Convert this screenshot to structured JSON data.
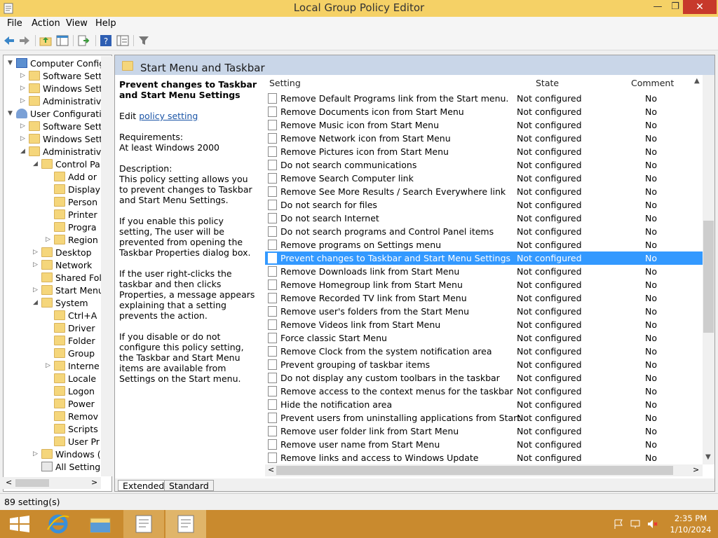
{
  "window": {
    "title": "Local Group Policy Editor"
  },
  "menu": [
    "File",
    "Action",
    "View",
    "Help"
  ],
  "tree": [
    {
      "label": "Computer Config",
      "level": 0,
      "exp": "▼",
      "icon": "computer-icon"
    },
    {
      "label": "Software Setti",
      "level": 1,
      "exp": "▷",
      "icon": "folder-icon"
    },
    {
      "label": "Windows Sett",
      "level": 1,
      "exp": "▷",
      "icon": "folder-icon"
    },
    {
      "label": "Administrative",
      "level": 1,
      "exp": "▷",
      "icon": "folder-icon"
    },
    {
      "label": "User Configuratio",
      "level": 0,
      "exp": "▼",
      "icon": "user-icon"
    },
    {
      "label": "Software Setti",
      "level": 1,
      "exp": "▷",
      "icon": "folder-icon"
    },
    {
      "label": "Windows Setti",
      "level": 1,
      "exp": "▷",
      "icon": "folder-icon"
    },
    {
      "label": "Administrative",
      "level": 1,
      "exp": "◢",
      "icon": "folder-icon"
    },
    {
      "label": "Control Pa",
      "level": 2,
      "exp": "◢",
      "icon": "folder-icon"
    },
    {
      "label": "Add or",
      "level": 3,
      "exp": "",
      "icon": "folder-icon"
    },
    {
      "label": "Display",
      "level": 3,
      "exp": "",
      "icon": "folder-icon"
    },
    {
      "label": "Person",
      "level": 3,
      "exp": "",
      "icon": "folder-icon"
    },
    {
      "label": "Printer",
      "level": 3,
      "exp": "",
      "icon": "folder-icon"
    },
    {
      "label": "Progra",
      "level": 3,
      "exp": "",
      "icon": "folder-icon"
    },
    {
      "label": "Region",
      "level": 3,
      "exp": "▷",
      "icon": "folder-icon"
    },
    {
      "label": "Desktop",
      "level": 2,
      "exp": "▷",
      "icon": "folder-icon"
    },
    {
      "label": "Network",
      "level": 2,
      "exp": "▷",
      "icon": "folder-icon"
    },
    {
      "label": "Shared Fol",
      "level": 2,
      "exp": "",
      "icon": "folder-icon"
    },
    {
      "label": "Start Menu",
      "level": 2,
      "exp": "▷",
      "icon": "folder-icon"
    },
    {
      "label": "System",
      "level": 2,
      "exp": "◢",
      "icon": "folder-icon"
    },
    {
      "label": "Ctrl+A",
      "level": 3,
      "exp": "",
      "icon": "folder-icon"
    },
    {
      "label": "Driver",
      "level": 3,
      "exp": "",
      "icon": "folder-icon"
    },
    {
      "label": "Folder",
      "level": 3,
      "exp": "",
      "icon": "folder-icon"
    },
    {
      "label": "Group",
      "level": 3,
      "exp": "",
      "icon": "folder-icon"
    },
    {
      "label": "Interne",
      "level": 3,
      "exp": "▷",
      "icon": "folder-icon"
    },
    {
      "label": "Locale",
      "level": 3,
      "exp": "",
      "icon": "folder-icon"
    },
    {
      "label": "Logon",
      "level": 3,
      "exp": "",
      "icon": "folder-icon"
    },
    {
      "label": "Power",
      "level": 3,
      "exp": "",
      "icon": "folder-icon"
    },
    {
      "label": "Remov",
      "level": 3,
      "exp": "",
      "icon": "folder-icon"
    },
    {
      "label": "Scripts",
      "level": 3,
      "exp": "",
      "icon": "folder-icon"
    },
    {
      "label": "User Pr",
      "level": 3,
      "exp": "",
      "icon": "folder-icon"
    },
    {
      "label": "Windows (",
      "level": 2,
      "exp": "▷",
      "icon": "folder-icon"
    },
    {
      "label": "All Setting",
      "level": 2,
      "exp": "",
      "icon": "settings-icon"
    }
  ],
  "panel": {
    "title": "Start Menu and Taskbar"
  },
  "description": {
    "title": "Prevent changes to Taskbar and Start Menu Settings",
    "edit_prefix": "Edit ",
    "edit_link": "policy setting",
    "requirements_label": "Requirements:",
    "requirements_value": "At least Windows 2000",
    "description_label": "Description:",
    "p1": "This policy setting allows you to prevent changes to Taskbar and Start Menu Settings.",
    "p2": "If you enable this policy setting, The user will be prevented from opening the Taskbar Properties dialog box.",
    "p3": "If the user right-clicks the taskbar and then clicks Properties, a message appears explaining that a setting prevents the action.",
    "p4": "If you disable or do not configure this policy setting, the Taskbar and Start Menu items are available from Settings on the Start menu."
  },
  "columns": {
    "setting": "Setting",
    "state": "State",
    "comment": "Comment"
  },
  "rows": [
    {
      "setting": "Remove Default Programs link from the Start menu.",
      "state": "Not configured",
      "comment": "No"
    },
    {
      "setting": "Remove Documents icon from Start Menu",
      "state": "Not configured",
      "comment": "No"
    },
    {
      "setting": "Remove Music icon from Start Menu",
      "state": "Not configured",
      "comment": "No"
    },
    {
      "setting": "Remove Network icon from Start Menu",
      "state": "Not configured",
      "comment": "No"
    },
    {
      "setting": "Remove Pictures icon from Start Menu",
      "state": "Not configured",
      "comment": "No"
    },
    {
      "setting": "Do not search communications",
      "state": "Not configured",
      "comment": "No"
    },
    {
      "setting": "Remove Search Computer link",
      "state": "Not configured",
      "comment": "No"
    },
    {
      "setting": "Remove See More Results / Search Everywhere link",
      "state": "Not configured",
      "comment": "No"
    },
    {
      "setting": "Do not search for files",
      "state": "Not configured",
      "comment": "No"
    },
    {
      "setting": "Do not search Internet",
      "state": "Not configured",
      "comment": "No"
    },
    {
      "setting": "Do not search programs and Control Panel items",
      "state": "Not configured",
      "comment": "No"
    },
    {
      "setting": "Remove programs on Settings menu",
      "state": "Not configured",
      "comment": "No"
    },
    {
      "setting": "Prevent changes to Taskbar and Start Menu Settings",
      "state": "Not configured",
      "comment": "No",
      "selected": true
    },
    {
      "setting": "Remove Downloads link from Start Menu",
      "state": "Not configured",
      "comment": "No"
    },
    {
      "setting": "Remove Homegroup link from Start Menu",
      "state": "Not configured",
      "comment": "No"
    },
    {
      "setting": "Remove Recorded TV link from Start Menu",
      "state": "Not configured",
      "comment": "No"
    },
    {
      "setting": "Remove user's folders from the Start Menu",
      "state": "Not configured",
      "comment": "No"
    },
    {
      "setting": "Remove Videos link from Start Menu",
      "state": "Not configured",
      "comment": "No"
    },
    {
      "setting": "Force classic Start Menu",
      "state": "Not configured",
      "comment": "No"
    },
    {
      "setting": "Remove Clock from the system notification area",
      "state": "Not configured",
      "comment": "No"
    },
    {
      "setting": "Prevent grouping of taskbar items",
      "state": "Not configured",
      "comment": "No"
    },
    {
      "setting": "Do not display any custom toolbars in the taskbar",
      "state": "Not configured",
      "comment": "No"
    },
    {
      "setting": "Remove access to the context menus for the taskbar",
      "state": "Not configured",
      "comment": "No"
    },
    {
      "setting": "Hide the notification area",
      "state": "Not configured",
      "comment": "No"
    },
    {
      "setting": "Prevent users from uninstalling applications from Start",
      "state": "Not configured",
      "comment": "No"
    },
    {
      "setting": "Remove user folder link from Start Menu",
      "state": "Not configured",
      "comment": "No"
    },
    {
      "setting": "Remove user name from Start Menu",
      "state": "Not configured",
      "comment": "No"
    },
    {
      "setting": "Remove links and access to Windows Update",
      "state": "Not configured",
      "comment": "No"
    }
  ],
  "tabs": [
    "Extended",
    "Standard"
  ],
  "status": "89 setting(s)",
  "clock": {
    "time": "2:35 PM",
    "date": "1/10/2024"
  },
  "colors": {
    "titlebar": "#f5d166",
    "taskbar": "#c98a2e",
    "selection": "#3399ff",
    "close": "#c7392b"
  }
}
